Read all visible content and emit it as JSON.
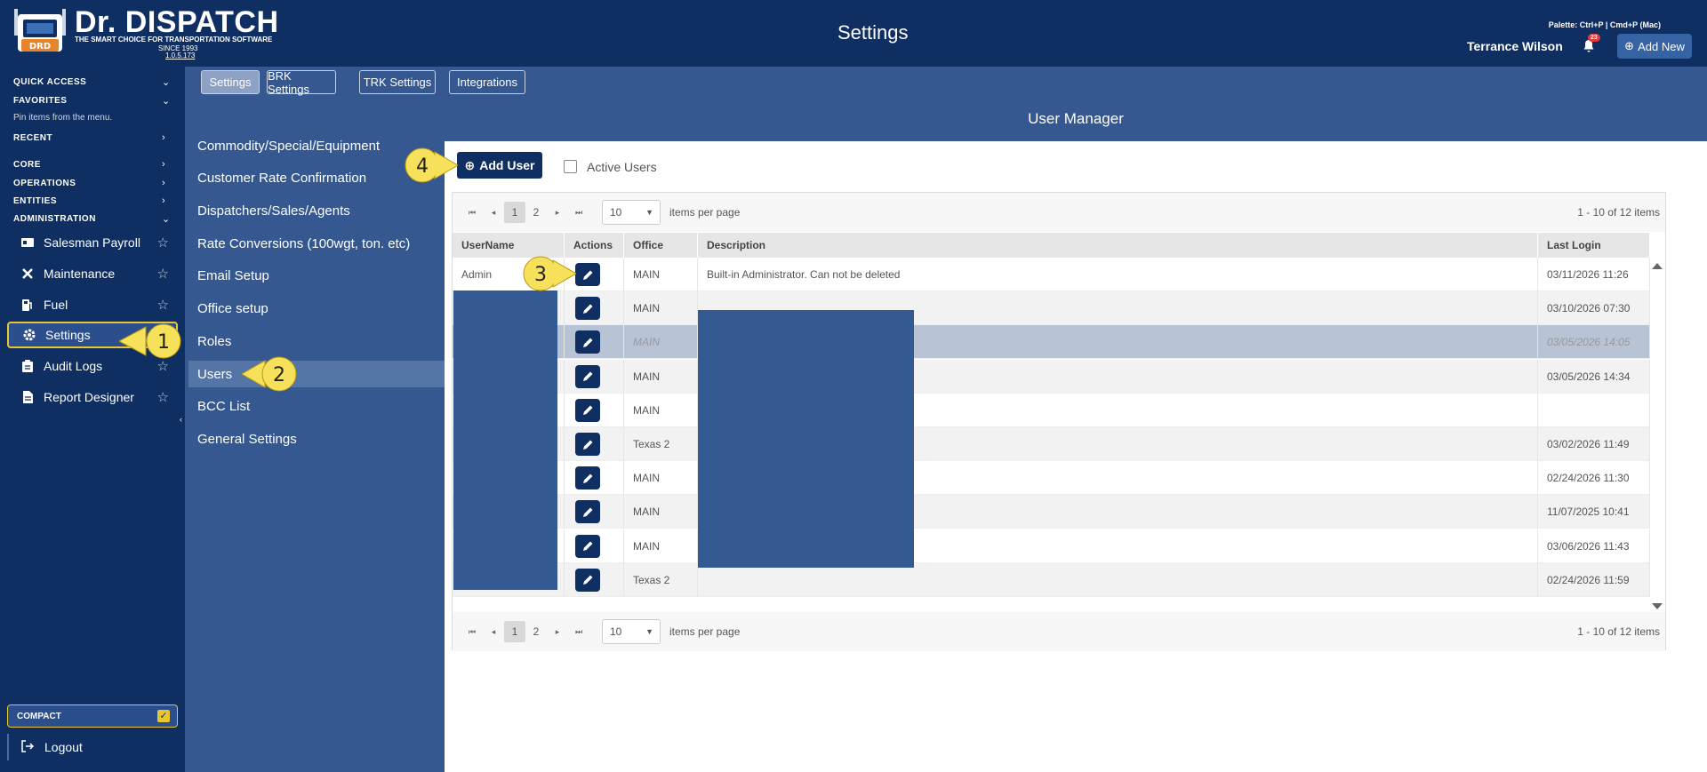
{
  "app": {
    "brand": "Dr. DISPATCH",
    "logo_text": "DRD",
    "tagline": "THE SMART CHOICE FOR TRANSPORTATION SOFTWARE",
    "since": "SINCE 1993",
    "version": "1.0.5.173",
    "page_title": "Settings",
    "palette_hint": "Palette: Ctrl+P | Cmd+P (Mac)",
    "user_name": "Terrance Wilson",
    "notification_count": "23",
    "add_new_label": "Add New"
  },
  "sidebar": {
    "sections": {
      "quick_access": "QUICK ACCESS",
      "favorites": "FAVORITES",
      "pin_note": "Pin items from the menu.",
      "recent": "RECENT",
      "core": "CORE",
      "operations": "OPERATIONS",
      "entities": "ENTITIES",
      "administration": "ADMINISTRATION"
    },
    "items": [
      {
        "label": "Salesman Payroll",
        "icon": "payroll-icon"
      },
      {
        "label": "Maintenance",
        "icon": "wrench-icon"
      },
      {
        "label": "Fuel",
        "icon": "fuel-icon"
      },
      {
        "label": "Settings",
        "icon": "gear-icon"
      },
      {
        "label": "Audit Logs",
        "icon": "clipboard-icon"
      },
      {
        "label": "Report Designer",
        "icon": "document-icon"
      }
    ],
    "compact_label": "COMPACT",
    "logout_label": "Logout"
  },
  "tabs": [
    {
      "label": "Settings"
    },
    {
      "label": "BRK Settings"
    },
    {
      "label": "TRK Settings"
    },
    {
      "label": "Integrations"
    }
  ],
  "submenu": [
    {
      "label": "Commodity/Special/Equipment"
    },
    {
      "label": "Customer Rate Confirmation"
    },
    {
      "label": "Dispatchers/Sales/Agents"
    },
    {
      "label": "Rate Conversions (100wgt, ton. etc)"
    },
    {
      "label": "Email Setup"
    },
    {
      "label": "Office setup"
    },
    {
      "label": "Roles"
    },
    {
      "label": "Users"
    },
    {
      "label": "BCC List"
    },
    {
      "label": "General Settings"
    }
  ],
  "user_manager": {
    "title": "User Manager",
    "add_user_label": "Add User",
    "active_users_label": "Active Users",
    "pager": {
      "pages": [
        "1",
        "2"
      ],
      "page_size": "10",
      "items_per_page": "items per page",
      "info": "1 - 10 of 12 items"
    },
    "columns": [
      "UserName",
      "Actions",
      "Office",
      "Description",
      "Last Login"
    ],
    "rows": [
      {
        "username": "Admin",
        "office": "MAIN",
        "description": "Built-in Administrator. Can not be deleted",
        "last_login": "03/11/2026 11:26"
      },
      {
        "username": "",
        "office": "MAIN",
        "description": "",
        "last_login": "03/10/2026 07:30"
      },
      {
        "username": "",
        "office": "MAIN",
        "description": "",
        "last_login": "03/05/2026 14:05"
      },
      {
        "username": "",
        "office": "MAIN",
        "description": "",
        "last_login": "03/05/2026 14:34"
      },
      {
        "username": "",
        "office": "MAIN",
        "description": "",
        "last_login": ""
      },
      {
        "username": "",
        "office": "Texas 2",
        "description": "",
        "last_login": "03/02/2026 11:49"
      },
      {
        "username": "",
        "office": "MAIN",
        "description": "",
        "last_login": "02/24/2026 11:30"
      },
      {
        "username": "",
        "office": "MAIN",
        "description": "",
        "last_login": "11/07/2025 10:41"
      },
      {
        "username": "",
        "office": "MAIN",
        "description": "",
        "last_login": "03/06/2026 11:43"
      },
      {
        "username": "",
        "office": "Texas 2",
        "description": "",
        "last_login": "02/24/2026 11:59"
      }
    ]
  },
  "callouts": [
    "1",
    "2",
    "3",
    "4"
  ],
  "colors": {
    "navy": "#0f2f63",
    "panel_blue": "#34588f",
    "highlight_yellow": "#f7e15a"
  }
}
